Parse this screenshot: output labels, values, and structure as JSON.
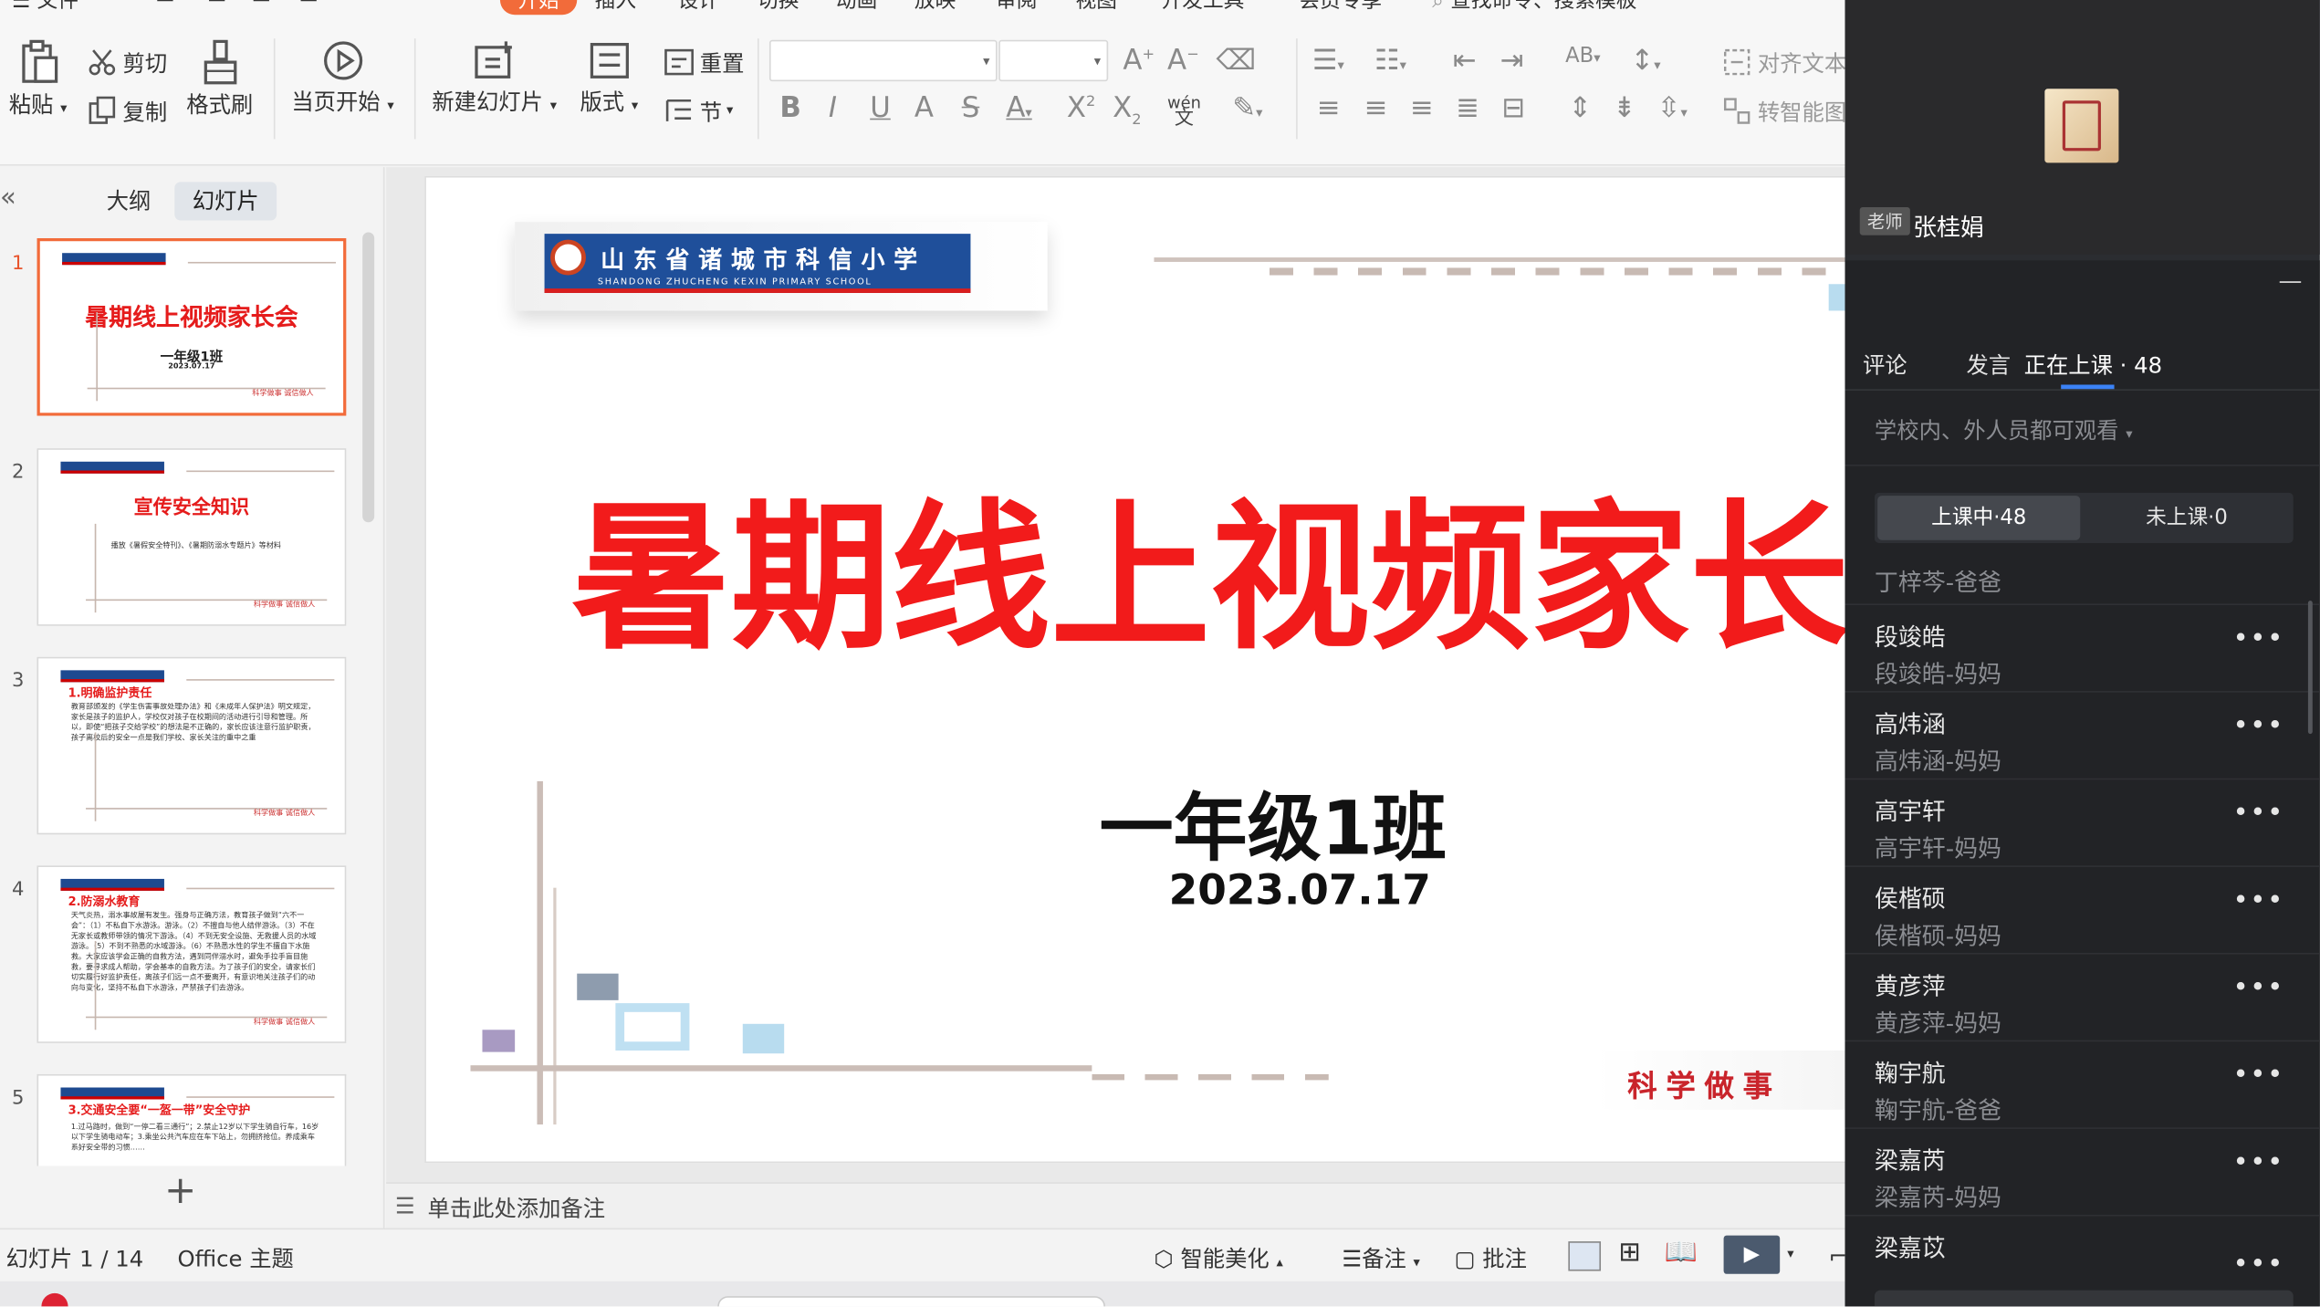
{
  "ribbon": {
    "menu": [
      "文件",
      "开始",
      "插入",
      "设计",
      "切换",
      "动画",
      "放映",
      "审阅",
      "视图",
      "开发工具",
      "会员专享"
    ],
    "search_placeholder": "查找命令、搜索模板",
    "paste": "粘贴",
    "cut": "剪切",
    "copy": "复制",
    "format_painter": "格式刷",
    "play_from_current": "当页开始",
    "new_slide": "新建幻灯片",
    "layout": "版式",
    "section": "节",
    "reset": "重置",
    "align_text": "对齐文本",
    "convert_smartart": "转智能图",
    "phonetic_line1": "wén",
    "phonetic_line2": "文"
  },
  "leftpanel": {
    "tab_outline": "大纲",
    "tab_slides": "幻灯片",
    "thumbs": [
      {
        "num": "1",
        "title": "暑期线上视频家长会",
        "sub": "一年级1班",
        "date": "2023.07.17"
      },
      {
        "num": "2",
        "title": "宣传安全知识",
        "body": "播放《暑假安全特刊》、《暑期防溺水专题片》等材料"
      },
      {
        "num": "3",
        "head": "1.明确监护责任",
        "body": "教育部颁发的《学生伤害事故处理办法》和《未成年人保护法》明文规定，家长是孩子的监护人，学校仅对孩子在校期间的活动进行引导和管理。所以，即使“把孩子交给学校”的想法是不正确的，家长应该注意行监护职责，孩子离校后的安全一点是我们学校、家长关注的重中之重"
      },
      {
        "num": "4",
        "head": "2.防溺水教育",
        "body": "天气炎热，溺水事故屡有发生。强身与正确方法，教育孩子做到“六不一会”：（1）不私自下水游泳。游泳。（2）不擅自与他人结伴游泳。（3）不在无家长或教师带领的情况下游泳。（4）不到无安全设施、无救援人员的水域游泳。（5）不到不熟悉的水域游泳。（6）不熟悉水性的学生不擅自下水施救。大家应该学会正确的自救方法，遇到同伴溺水时，避免手拉手盲目施救，要寻求成人帮助，学会基本的自救方法。为了孩子们的安全，请家长们切实履行好监护责任，离孩子们远一点不要离开，有意识地关注孩子们的动向与变化，坚持不私自下水游泳，严禁孩子们去游泳。"
      },
      {
        "num": "5",
        "head": "3.交通安全要“一盔一带”安全守护",
        "body": "1.过马路时，做到“一停二看三通行”；2.禁止12岁以下学生骑自行车，16岁以下学生骑电动车；3.乘坐公共汽车应在车下站上，勿拥挤抢位。养成乘车系好安全带的习惯……"
      }
    ],
    "thumb_footer": "科学做事 诚信做人"
  },
  "slide": {
    "school_cn": "山东省诸城市科信小学",
    "school_en": "SHANDONG ZHUCHENG KEXIN PRIMARY SCHOOL",
    "title": "暑期线上视频家长",
    "class_name": "一年级1班",
    "date": "2023.07.17",
    "motto": "科学做事"
  },
  "notes": {
    "placeholder": "单击此处添加备注"
  },
  "statusbar": {
    "slide_counter": "幻灯片 1 / 14",
    "theme": "Office 主题",
    "beautify": "智能美化",
    "notes": "备注",
    "comments": "批注"
  },
  "rightpanel": {
    "teacher_badge": "老师",
    "teacher_name": "张桂娟",
    "tabs": [
      "评论",
      "发言",
      "正在上课 · 48"
    ],
    "visibility": "学校内、外人员都可观看",
    "seg_in_class": "上课中·48",
    "seg_not_in_class": "未上课·0",
    "partial_member": "丁梓芩-爸爸",
    "members": [
      {
        "name": "段竣皓",
        "sub": "段竣皓-妈妈"
      },
      {
        "name": "高炜涵",
        "sub": "高炜涵-妈妈"
      },
      {
        "name": "高宇轩",
        "sub": "高宇轩-妈妈"
      },
      {
        "name": "侯楷硕",
        "sub": "侯楷硕-妈妈"
      },
      {
        "name": "黄彦萍",
        "sub": "黄彦萍-妈妈"
      },
      {
        "name": "鞠宇航",
        "sub": "鞠宇航-爸爸"
      },
      {
        "name": "梁嘉芮",
        "sub": "梁嘉芮-妈妈"
      },
      {
        "name": "梁嘉苡",
        "sub": ""
      }
    ],
    "more_label": "•••"
  },
  "colors": {
    "accent_red": "#e51c1c",
    "selection_orange": "#f26b3a",
    "panel_dark": "#222326",
    "tab_underline": "#3b82f6"
  }
}
